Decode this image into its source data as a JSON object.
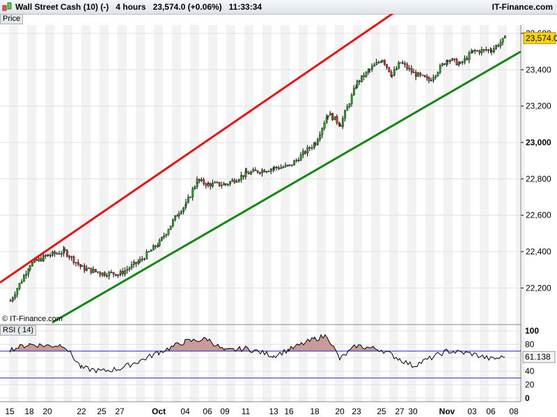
{
  "header": {
    "title": "Wall Street Cash (10) (-)   4 hours   23,574.0 (+0.06%)   11:33:34",
    "brand": "IT-Finance.com"
  },
  "price_panel_label": "Price",
  "rsi_panel_label": "RSI ( 14)",
  "copyright": "© IT-Finance.com",
  "colors": {
    "up": "#22aa22",
    "down": "#dd3333",
    "resistance": "#ee1111",
    "support": "#118811",
    "rsi_fill": "#c89a9a",
    "rsi_lines": "#2222cc",
    "last_tag": "#ffd700"
  },
  "chart_data": [
    {
      "type": "candlestick",
      "title": "Wall Street Cash (10) (-)",
      "interval": "4 hours",
      "last": "23,574.0",
      "change": "+0.06%",
      "yticks": [
        "22,200",
        "22,400",
        "22,600",
        "22,800",
        "23,000",
        "23,200",
        "23,400",
        "23,600"
      ],
      "ylim": [
        22100,
        23650
      ],
      "xticks": [
        "15",
        "18",
        "20",
        "22",
        "25",
        "27",
        "Oct",
        "04",
        "06",
        "09",
        "11",
        "13",
        "16",
        "18",
        "20",
        "23",
        "25",
        "27",
        "30",
        "Nov",
        "03",
        "06",
        "08"
      ],
      "x": [
        "15",
        "18",
        "20",
        "21",
        "22",
        "25",
        "27",
        "29",
        "Oct",
        "03",
        "04",
        "05",
        "06",
        "09",
        "11",
        "13",
        "16",
        "18",
        "19",
        "20",
        "23",
        "24",
        "25",
        "26",
        "27",
        "30",
        "31",
        "Nov",
        "02",
        "03",
        "06",
        "07"
      ],
      "close": [
        22130,
        22330,
        22380,
        22400,
        22310,
        22280,
        22280,
        22350,
        22450,
        22620,
        22660,
        22790,
        22770,
        22770,
        22830,
        22860,
        22870,
        23000,
        23160,
        23100,
        23330,
        23400,
        23460,
        23370,
        23440,
        23380,
        23340,
        23460,
        23430,
        23500,
        23510,
        23574
      ],
      "trendlines": [
        {
          "role": "resistance",
          "from": 22230,
          "to": 23890
        },
        {
          "role": "support",
          "from": 22010,
          "to": 23500
        }
      ]
    },
    {
      "type": "line",
      "title": "RSI ( 14)",
      "ylim": [
        0,
        100
      ],
      "yticks": [
        "0",
        "20",
        "40",
        "60",
        "80",
        "100"
      ],
      "levels": [
        30,
        70
      ],
      "last": "61.138",
      "x": [
        "15",
        "18",
        "20",
        "21",
        "22",
        "25",
        "27",
        "29",
        "Oct",
        "04",
        "06",
        "09",
        "11",
        "13",
        "16",
        "18",
        "19",
        "20",
        "23",
        "25",
        "27",
        "30",
        "Nov",
        "03",
        "06",
        "07"
      ],
      "values": [
        72,
        80,
        78,
        79,
        45,
        40,
        44,
        55,
        68,
        84,
        88,
        70,
        74,
        63,
        72,
        88,
        93,
        58,
        78,
        72,
        58,
        48,
        70,
        66,
        58,
        61
      ]
    }
  ]
}
